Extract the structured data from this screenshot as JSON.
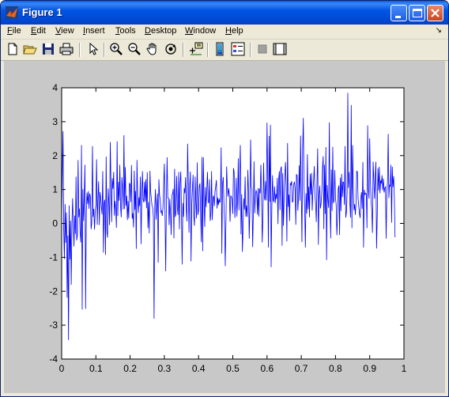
{
  "window": {
    "title": "Figure 1",
    "title_bar_color": "#0055e5",
    "minimize_icon": "minimize-icon",
    "maximize_icon": "maximize-icon",
    "close_icon": "close-icon"
  },
  "menubar": {
    "items": [
      {
        "label": "File",
        "mnemonic": "F",
        "rest": "ile"
      },
      {
        "label": "Edit",
        "mnemonic": "E",
        "rest": "dit"
      },
      {
        "label": "View",
        "mnemonic": "V",
        "rest": "iew"
      },
      {
        "label": "Insert",
        "mnemonic": "I",
        "rest": "nsert"
      },
      {
        "label": "Tools",
        "mnemonic": "T",
        "rest": "ools"
      },
      {
        "label": "Desktop",
        "mnemonic": "D",
        "rest": "esktop"
      },
      {
        "label": "Window",
        "mnemonic": "W",
        "rest": "indow"
      },
      {
        "label": "Help",
        "mnemonic": "H",
        "rest": "elp"
      }
    ],
    "dock_arrow": "↘"
  },
  "toolbar": {
    "icons": [
      "new-figure-icon",
      "open-file-icon",
      "save-icon",
      "print-icon",
      "edit-plot-arrow-icon",
      "zoom-in-icon",
      "zoom-out-icon",
      "pan-hand-icon",
      "rotate-3d-icon",
      "data-cursor-icon",
      "colorbar-icon",
      "legend-icon",
      "hide-plot-tools-icon",
      "show-plot-tools-icon"
    ]
  },
  "chart_data": {
    "type": "line",
    "line_color": "#0000ff",
    "background": "#ffffff",
    "xlim": [
      0,
      1
    ],
    "ylim": [
      -4,
      4
    ],
    "x_ticks": [
      "0",
      "0.1",
      "0.2",
      "0.3",
      "0.4",
      "0.5",
      "0.6",
      "0.7",
      "0.8",
      "0.9",
      "1"
    ],
    "y_ticks": [
      "4",
      "3",
      "2",
      "1",
      "0",
      "-1",
      "-2",
      "-3",
      "-4"
    ],
    "grid": false,
    "title": "",
    "xlabel": "",
    "ylabel": "",
    "x_start": 0,
    "x_step": 0.002,
    "y": [
      0.13,
      1.55,
      2.72,
      -0.18,
      -1.05,
      0.57,
      -0.57,
      0.32,
      -2.19,
      -0.36,
      -3.44,
      0.53,
      -1.06,
      0.08,
      -1.81,
      -0.02,
      0.74,
      -0.05,
      -0.68,
      0.23,
      -0.31,
      1.38,
      -0.5,
      -0.33,
      1.87,
      0.18,
      0.44,
      -0.29,
      -0.56,
      2.31,
      -2.54,
      1.01,
      0.07,
      0.81,
      1.73,
      -2.52,
      0.34,
      0.91,
      0.57,
      0.95,
      0.43,
      0.88,
      0.79,
      -0.17,
      0.02,
      2.28,
      0.19,
      0.43,
      -0.18,
      0.33,
      0.55,
      1.89,
      -0.04,
      0.75,
      1.24,
      -0.05,
      0.92,
      0.75,
      0.48,
      0.27,
      1.54,
      -0.86,
      0.59,
      0.7,
      -0.93,
      1.97,
      -0.24,
      -0.42,
      1.03,
      0.62,
      -0.05,
      2.4,
      1.17,
      0.04,
      1.33,
      1.02,
      1.52,
      0.23,
      0.66,
      0.42,
      -0.13,
      2.42,
      0.22,
      1.22,
      0.67,
      1.73,
      0.52,
      0.18,
      1.36,
      1.06,
      0.41,
      2.6,
      0.43,
      1.66,
      0.52,
      0.82,
      0.1,
      0.66,
      0.15,
      1.19,
      1.15,
      0.63,
      1.72,
      0.14,
      0.3,
      -0.12,
      1.55,
      0.4,
      0.96,
      -0.75,
      1.87,
      0.83,
      0.31,
      0.77,
      0.51,
      1.38,
      -0.61,
      0.79,
      1.54,
      0.7,
      0.62,
      1.23,
      0.65,
      1.3,
      0.45,
      1.51,
      -0.14,
      0.63,
      -0.29,
      1.55,
      0.94,
      0.72,
      0.52,
      0.46,
      0.19,
      -2.81,
      0.45,
      1.01,
      0.11,
      0.54,
      0.88,
      -1.16,
      1.3,
      0.83,
      0.71,
      0.33,
      0.37,
      0.22,
      0.48,
      1.13,
      1.76,
      0.26,
      -1.41,
      0.66,
      1.95,
      0.75,
      0.75,
      -0.05,
      0.72,
      0.31,
      -0.34,
      0.82,
      0.88,
      1.02,
      -0.44,
      1.61,
      0.19,
      0.3,
      1.4,
      0.46,
      0.25,
      1.52,
      -0.17,
      1.17,
      1.53,
      0.43,
      -1.21,
      0.6,
      0.19,
      1.04,
      0.89,
      1.36,
      0.45,
      0.06,
      2.35,
      1.22,
      -0.27,
      1.1,
      1.53,
      -1.12,
      0.55,
      1.03,
      1.43,
      0.2,
      -0.07,
      1.38,
      0.64,
      0.15,
      1.8,
      0.25,
      0.39,
      1.09,
      1.18,
      0.32,
      -0.55,
      1.96,
      -0.82,
      1.95,
      0.69,
      -0.1,
      1.07,
      0.48,
      0.98,
      1.52,
      0.64,
      0.6,
      1.3,
      0.07,
      0.28,
      1.54,
      0.1,
      0.76,
      0.82,
      0.51,
      0.94,
      1.08,
      1.28,
      0.44,
      0.76,
      0.54,
      0.73,
      0.61,
      0.7,
      2.24,
      -0.89,
      1.16,
      1.37,
      0.62,
      0.03,
      -1.26,
      0.08,
      1.68,
      1.07,
      0.79,
      1.04,
      0.84,
      0.05,
      0.81,
      0.79,
      0.69,
      0.28,
      1.63,
      1.5,
      0.16,
      0.55,
      1.34,
      0.2,
      0.71,
      1.92,
      0.39,
      1.46,
      2.31,
      -0.32,
      0.86,
      -0.84,
      -0.11,
      0.74,
      0.41,
      1.38,
      0.2,
      0.53,
      0.19,
      1.58,
      0.91,
      -0.45,
      0.47,
      2.47,
      1.08,
      0.99,
      -0.7,
      0.28,
      1.83,
      0.3,
      0.81,
      0.98,
      0.89,
      0.26,
      1.04,
      0.2,
      1.03,
      0.89,
      1.73,
      0.83,
      -0.56,
      0.18,
      1.79,
      0.77,
      0.68,
      1.25,
      0.68,
      2.97,
      1.43,
      -0.71,
      2.58,
      0.64,
      2.91,
      -1.29,
      0.44,
      1.42,
      0.69,
      0.63,
      1.09,
      0.6,
      0.87,
      0.72,
      1.34,
      -0.02,
      1.28,
      1.54,
      0.4,
      1.6,
      1.68,
      -0.66,
      1.48,
      -0.07,
      0.75,
      1.43,
      1.81,
      1.05,
      -0.53,
      2.37,
      0.49,
      0.85,
      0.07,
      1.19,
      1.14,
      1.25,
      0.62,
      0.66,
      1.14,
      1.23,
      1.03,
      -0.04,
      1.44,
      1.42,
      0.38,
      0.75,
      1.71,
      0.67,
      2.59,
      0.98,
      -0.55,
      2.14,
      3.11,
      1.13,
      0.48,
      -0.71,
      0.89,
      0.29,
      2.04,
      0.42,
      1.08,
      0.18,
      1.46,
      0.85,
      1.49,
      0.38,
      0.96,
      1.24,
      1.69,
      0.83,
      0.57,
      0.04,
      1.21,
      2.21,
      -0.63,
      0.84,
      1.11,
      0.44,
      0.59,
      0.93,
      1.62,
      1.98,
      -0.17,
      1.73,
      0.28,
      2.25,
      -1.08,
      1.13,
      0.69,
      0.46,
      2.98,
      0.57,
      -0.44,
      1.59,
      0.37,
      2.26,
      0.6,
      0.68,
      1.57,
      0.74,
      0.56,
      -0.35,
      0.19,
      1.01,
      1.12,
      -0.34,
      1.35,
      0.37,
      1.46,
      0.78,
      1.22,
      1.21,
      0.55,
      2.28,
      0.17,
      0.33,
      0.91,
      3.85,
      1.05,
      1.52,
      0.59,
      0.17,
      3.49,
      -0.14,
      2.31,
      1.04,
      0.39,
      0.57,
      0.25,
      0.59,
      1.54,
      1.52,
      0.73,
      0.5,
      0.3,
      0.16,
      0.74,
      0.92,
      0.43,
      1.81,
      -0.71,
      0.99,
      0.85,
      0.89,
      0.87,
      -0.14,
      2.89,
      1.01,
      0.73,
      2.51,
      1.28,
      0.66,
      0.39,
      -0.28,
      1.82,
      1.3,
      0.73,
      1.36,
      1.82,
      -0.74,
      0.22,
      1.63,
      0.97,
      1.67,
      0.89,
      1.27,
      1.18,
      1.42,
      0.98,
      1.32,
      0.91,
      1.04,
      1.09,
      -0.45,
      0.89,
      1.22,
      2.64,
      0.75,
      1.14,
      1.09,
      1.73,
      0.02,
      1.67,
      1.07,
      1.39,
      0.75,
      -0.41
    ]
  }
}
